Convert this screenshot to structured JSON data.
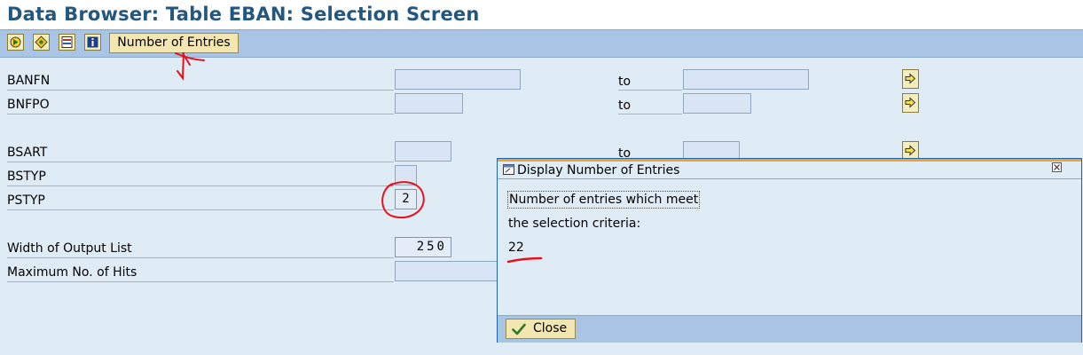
{
  "window": {
    "title": "Data Browser: Table EBAN: Selection Screen"
  },
  "toolbar": {
    "icons": [
      "execute-icon",
      "selection-options-icon",
      "field-selection-icon",
      "info-icon"
    ],
    "number_of_entries_label": "Number of Entries"
  },
  "selection": {
    "rows": [
      {
        "label": "BANFN",
        "to_label": "to",
        "has_range": true
      },
      {
        "label": "BNFPO",
        "to_label": "to",
        "has_range": true
      },
      {
        "label": "BSART",
        "to_label": "to",
        "has_range": true
      },
      {
        "label": "BSTYP",
        "has_range": false
      },
      {
        "label": "PSTYP",
        "value": "2",
        "has_range": false
      }
    ],
    "settings": [
      {
        "label": "Width of Output List",
        "value": "250"
      },
      {
        "label": "Maximum No. of Hits",
        "value": ""
      }
    ]
  },
  "popup": {
    "title": "Display Number of Entries",
    "line1": "Number of entries which meet",
    "line2": "the selection criteria:",
    "count": "22",
    "close_label": "Close"
  },
  "colors": {
    "title": "#23577f",
    "toolbar": "#a9c5e6",
    "background": "#dfebf5",
    "annotation": "#e8101a"
  }
}
